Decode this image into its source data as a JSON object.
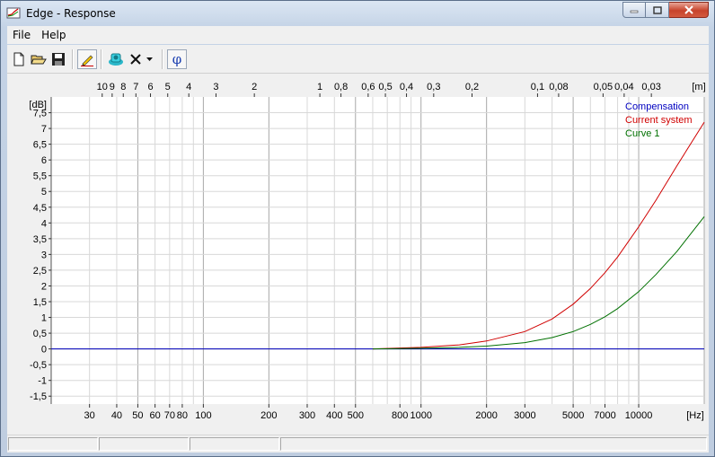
{
  "window": {
    "title": "Edge - Response"
  },
  "menu": [
    "File",
    "Help"
  ],
  "toolbar": {
    "icons": [
      "new-file-icon",
      "open-folder-icon",
      "save-disk-icon",
      "pencil-icon",
      "speaker-icon",
      "delete-x-icon",
      "dropdown-arrow-icon",
      "phase-phi-icon"
    ],
    "phase_label": "φ"
  },
  "chart_data": {
    "type": "line",
    "x_scale": "log",
    "xlabel": "[Hz]",
    "ylabel": "[dB]",
    "top_axis_label": "[m]",
    "xlim": [
      20,
      20000
    ],
    "ylim": [
      -1.75,
      8
    ],
    "x_ticks": [
      30,
      40,
      50,
      60,
      70,
      80,
      100,
      200,
      300,
      400,
      500,
      800,
      1000,
      2000,
      3000,
      5000,
      7000,
      10000
    ],
    "x_tick_labels": [
      "30",
      "40",
      "50",
      "60",
      "70",
      "80",
      "100",
      "200",
      "300",
      "400",
      "500",
      "800",
      "1000",
      "2000",
      "3000",
      "5000",
      "7000",
      "10000"
    ],
    "top_ticks": [
      10,
      9,
      8,
      7,
      6,
      5,
      4,
      3,
      2,
      1,
      0.8,
      0.6,
      0.5,
      0.4,
      0.3,
      0.2,
      0.1,
      0.08,
      0.05,
      0.04,
      0.03
    ],
    "top_tick_labels": [
      "10",
      "9",
      "8",
      "7",
      "6",
      "5",
      "4",
      "3",
      "2",
      "1",
      "0,8",
      "0,6",
      "0,5",
      "0,4",
      "0,3",
      "0,2",
      "0,1",
      "0,08",
      "0,05",
      "0,04",
      "0,03"
    ],
    "y_ticks": [
      7.5,
      7,
      6.5,
      6,
      5.5,
      5,
      4.5,
      4,
      3.5,
      3,
      2.5,
      2,
      1.5,
      1,
      0.5,
      0,
      -0.5,
      -1,
      -1.5
    ],
    "y_tick_labels": [
      "7,5",
      "7",
      "6,5",
      "6",
      "5,5",
      "5",
      "4,5",
      "4",
      "3,5",
      "3",
      "2,5",
      "2",
      "1,5",
      "1",
      "0,5",
      "0",
      "-0,5",
      "-1",
      "-1,5"
    ],
    "grid": true,
    "legend": "top-right",
    "series": [
      {
        "name": "Compensation",
        "color": "#0000c0",
        "x": [
          20,
          100,
          500,
          1000,
          5000,
          10000,
          20000
        ],
        "y": [
          0,
          0,
          0,
          0,
          0,
          0,
          0
        ]
      },
      {
        "name": "Current system",
        "color": "#d00000",
        "x": [
          600,
          800,
          1000,
          1500,
          2000,
          3000,
          4000,
          5000,
          6000,
          7000,
          8000,
          10000,
          12000,
          15000,
          20000
        ],
        "y": [
          0,
          0.03,
          0.05,
          0.13,
          0.25,
          0.55,
          0.95,
          1.42,
          1.92,
          2.42,
          2.92,
          3.88,
          4.72,
          5.82,
          7.2
        ]
      },
      {
        "name": "Curve 1",
        "color": "#007000",
        "x": [
          600,
          800,
          1000,
          1500,
          2000,
          3000,
          4000,
          5000,
          6000,
          7000,
          8000,
          10000,
          12000,
          15000,
          20000
        ],
        "y": [
          0,
          0.01,
          0.02,
          0.05,
          0.09,
          0.2,
          0.36,
          0.55,
          0.78,
          1.02,
          1.28,
          1.82,
          2.36,
          3.1,
          4.2
        ]
      }
    ]
  }
}
